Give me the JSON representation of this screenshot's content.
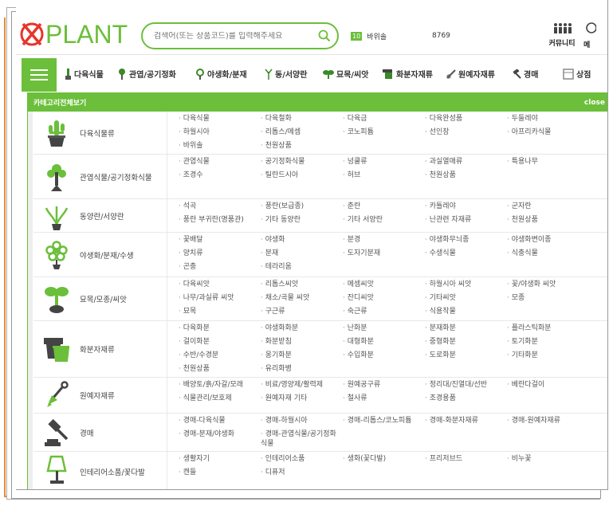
{
  "header": {
    "logo_text": "PLANT",
    "logo_mark": "X",
    "search_placeholder": "검색어(또는 상품코드)를 입력해주세요",
    "rank_number": "10",
    "rank_keyword": "바위솔",
    "count_text": "8769",
    "community_label": "커뮤니티",
    "me_label": "메"
  },
  "nav": {
    "items": [
      {
        "label": "다육식물",
        "icon": "succulent-icon"
      },
      {
        "label": "관엽/공기정화",
        "icon": "foliage-icon"
      },
      {
        "label": "야생화/분재",
        "icon": "wildflower-icon"
      },
      {
        "label": "동/서양란",
        "icon": "orchid-icon"
      },
      {
        "label": "묘목/씨앗",
        "icon": "sprout-icon"
      },
      {
        "label": "화분자재류",
        "icon": "pot-icon"
      },
      {
        "label": "원예자재류",
        "icon": "tools-icon"
      },
      {
        "label": "경매",
        "icon": "gavel-icon"
      },
      {
        "label": "상점",
        "icon": "shop-icon"
      }
    ]
  },
  "panel": {
    "title": "카테고리전체보기",
    "close_label": "close",
    "categories": [
      {
        "name": "다육식물류",
        "icon": "cactus-icon",
        "items": [
          "다육식물",
          "다육철화",
          "다육금",
          "다육완성품",
          "두들레야",
          "하월시아",
          "리톱스/메셈",
          "코노피튬",
          "선인장",
          "아프리카식물",
          "바위솔",
          "천원상품"
        ]
      },
      {
        "name": "관엽식물/공기정화식물",
        "icon": "tree-icon",
        "items": [
          "관엽식물",
          "공기정화식물",
          "넝쿨류",
          "과실열매류",
          "특용나무",
          "조경수",
          "틸란드시아",
          "허브",
          "천원상품"
        ]
      },
      {
        "name": "동양란/서양란",
        "icon": "orchid-icon",
        "items": [
          "석곡",
          "풍란(보급종)",
          "춘란",
          "카틀레야",
          "군자란",
          "풍란 부귀란(명품관)",
          "기타 동양란",
          "기타 서양란",
          "난관련 자재류",
          "천원상품"
        ]
      },
      {
        "name": "야생화/분재/수생",
        "icon": "flower-icon",
        "items": [
          "꽃배달",
          "야생화",
          "분경",
          "야생화무늬종",
          "야생화변이종",
          "양치류",
          "분재",
          "도자기분재",
          "수생식물",
          "식충식물",
          "곤충",
          "테라리움"
        ]
      },
      {
        "name": "묘목/모종/씨앗",
        "icon": "seedling-icon",
        "items": [
          "다육씨앗",
          "리톱스씨앗",
          "메셈씨앗",
          "하월시아 씨앗",
          "꽃/야생화 씨앗",
          "나무/과실류 씨앗",
          "채소/곡물 씨앗",
          "잔디씨앗",
          "기타씨앗",
          "모종",
          "묘목",
          "구근류",
          "숙근류",
          "식용작물"
        ]
      },
      {
        "name": "화분자재류",
        "icon": "pot-icon",
        "items": [
          "다육화분",
          "야생화화분",
          "난화분",
          "분재화분",
          "플라스틱화분",
          "걸이화분",
          "화분받침",
          "대형화분",
          "중형화분",
          "토기화분",
          "수반/수경분",
          "옹기화분",
          "수입화분",
          "도로화분",
          "기타화분",
          "천원상품",
          "유리화병"
        ]
      },
      {
        "name": "원예자재류",
        "icon": "shovel-icon",
        "items": [
          "배양토/흙/자갈/모래",
          "비료/영양제/활력제",
          "원예공구류",
          "정리대/진열대/선반",
          "베란다걸이",
          "식물관리/보호제",
          "원예자재 기타",
          "철사류",
          "조경용품"
        ]
      },
      {
        "name": "경매",
        "icon": "gavel-icon",
        "items": [
          "경매-다육식물",
          "경매-하월시아",
          "경매-리톱스/코노피튬",
          "경매-화분자재류",
          "경매-원예자재류",
          "경매-분재/야생화",
          "경매-관엽식물/공기정화식물"
        ]
      },
      {
        "name": "인테리어소품/꽃다발",
        "icon": "lamp-icon",
        "items": [
          "생활자기",
          "인테리어소품",
          "생화(꽃다발)",
          "프리저브드",
          "비누꽃",
          "캔들",
          "디퓨저"
        ]
      }
    ]
  },
  "colors": {
    "brand": "#6bbf3a",
    "logo_red": "#e8342a",
    "accent_orange": "#e88a3a"
  }
}
